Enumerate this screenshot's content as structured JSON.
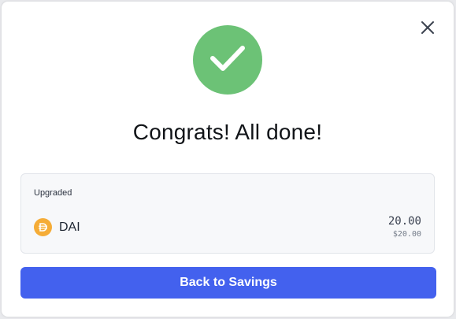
{
  "modal": {
    "title": "Congrats! All done!",
    "success_color": "#6cc276",
    "close_icon": "close-icon",
    "check_icon": "check-icon"
  },
  "summary": {
    "label": "Upgraded",
    "token": {
      "symbol": "DAI",
      "icon": "dai-token-icon",
      "icon_color": "#f5ac37",
      "amount": "20.00",
      "amount_usd": "$20.00"
    }
  },
  "actions": {
    "back_label": "Back to Savings",
    "button_color": "#4361ee"
  }
}
